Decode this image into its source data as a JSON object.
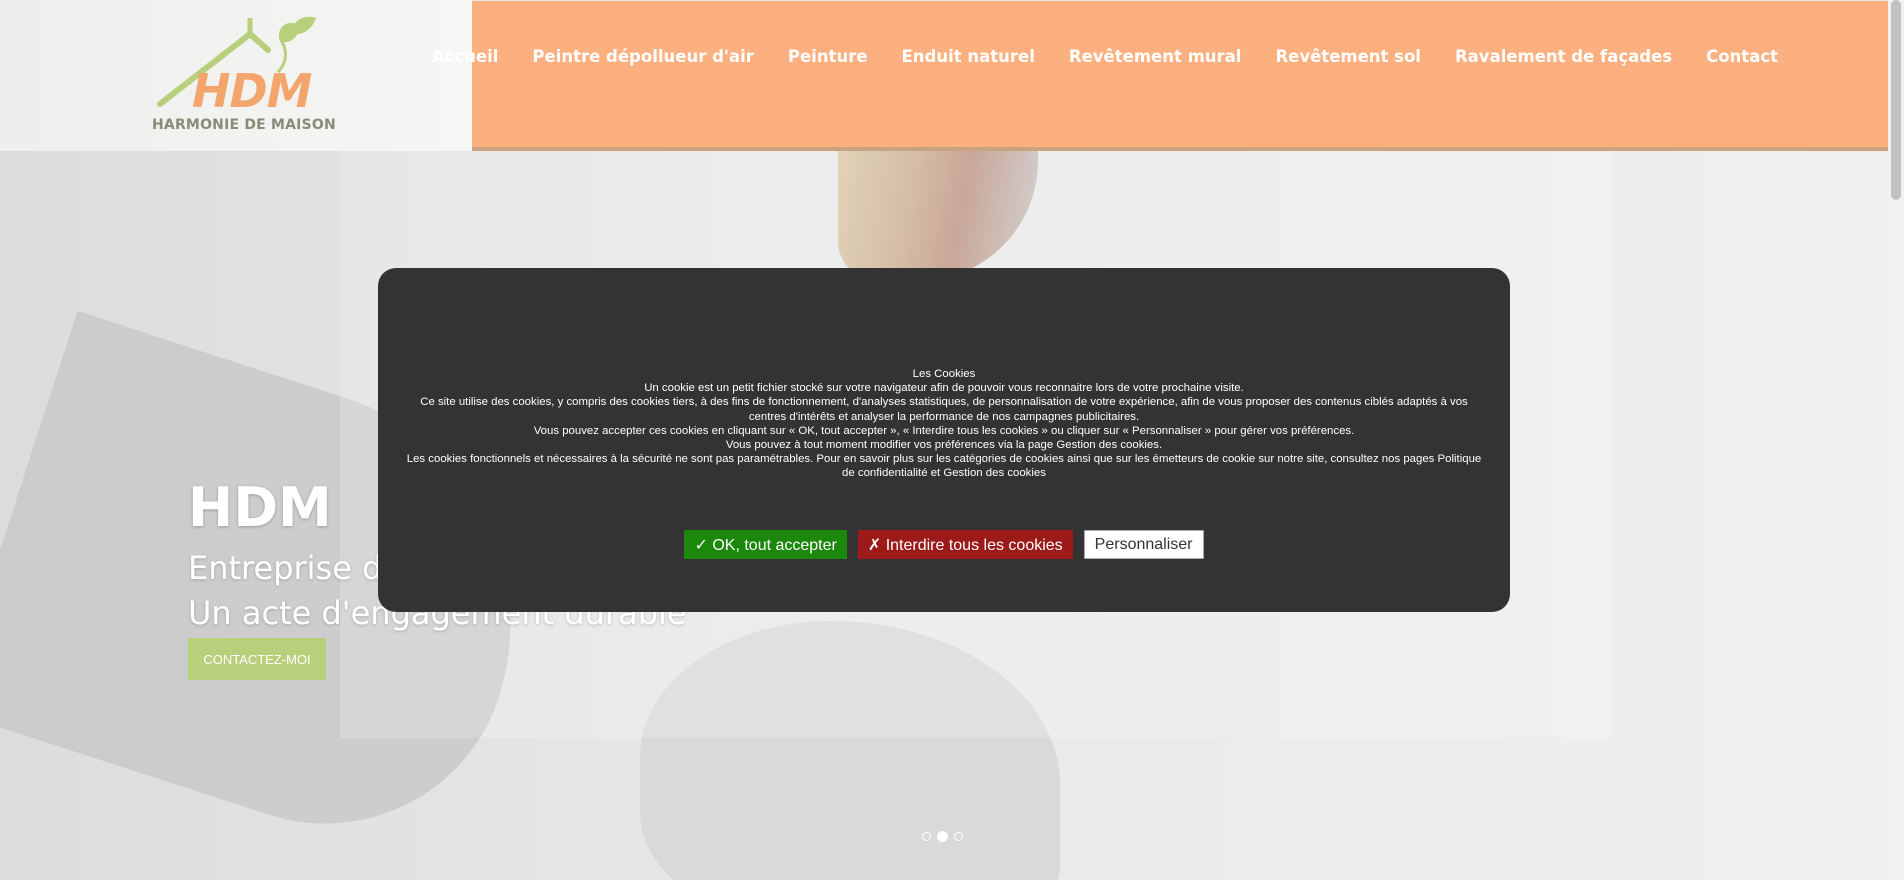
{
  "logo": {
    "brand": "HDM",
    "tagline": "HARMONIE DE MAISON"
  },
  "nav": {
    "items": [
      {
        "label": "Accueil"
      },
      {
        "label": "Peintre dépollueur d'air"
      },
      {
        "label": "Peinture"
      },
      {
        "label": "Enduit naturel"
      },
      {
        "label": "Revêtement mural"
      },
      {
        "label": "Revêtement sol"
      },
      {
        "label": "Ravalement de façades"
      },
      {
        "label": "Contact"
      }
    ]
  },
  "hero": {
    "title": "HDM",
    "subtitle_line1": "Entreprise d",
    "subtitle_line2": "Un acte d'engagement durable",
    "cta": "CONTACTEZ-MOI",
    "slides": 3,
    "active_slide": 2
  },
  "cookies": {
    "title": "Les Cookies",
    "lines": [
      "Un cookie est un petit fichier stocké sur votre navigateur afin de pouvoir vous reconnaitre lors de votre prochaine visite.",
      "Ce site utilise des cookies, y compris des cookies tiers, à des fins de fonctionnement, d'analyses statistiques, de personnalisation de votre expérience, afin de vous proposer des contenus ciblés adaptés à vos centres d'intérêts et analyser la performance de nos campagnes publicitaires.",
      "Vous pouvez accepter ces cookies en cliquant sur « OK, tout accepter », «  Interdire tous les cookies  » ou cliquer sur « Personnaliser » pour gérer vos préférences.",
      "Vous pouvez à tout moment modifier vos préférences via la page Gestion des cookies.",
      "Les cookies fonctionnels et nécessaires à la sécurité ne sont pas paramétrables. Pour en savoir plus sur les catégories de cookies ainsi que sur les émetteurs de cookie sur notre site, consultez nos pages Politique de confidentialité et Gestion des cookies"
    ],
    "accept_label": "✓ OK, tout accepter",
    "deny_label": "✗ Interdire tous les cookies",
    "customize_label": "Personnaliser"
  },
  "colors": {
    "nav_bg": "#fdb07f",
    "accent_green": "#b8cf7c",
    "accept_bg": "#1b870b",
    "deny_bg": "#9c1a1a",
    "modal_bg": "#333333"
  }
}
